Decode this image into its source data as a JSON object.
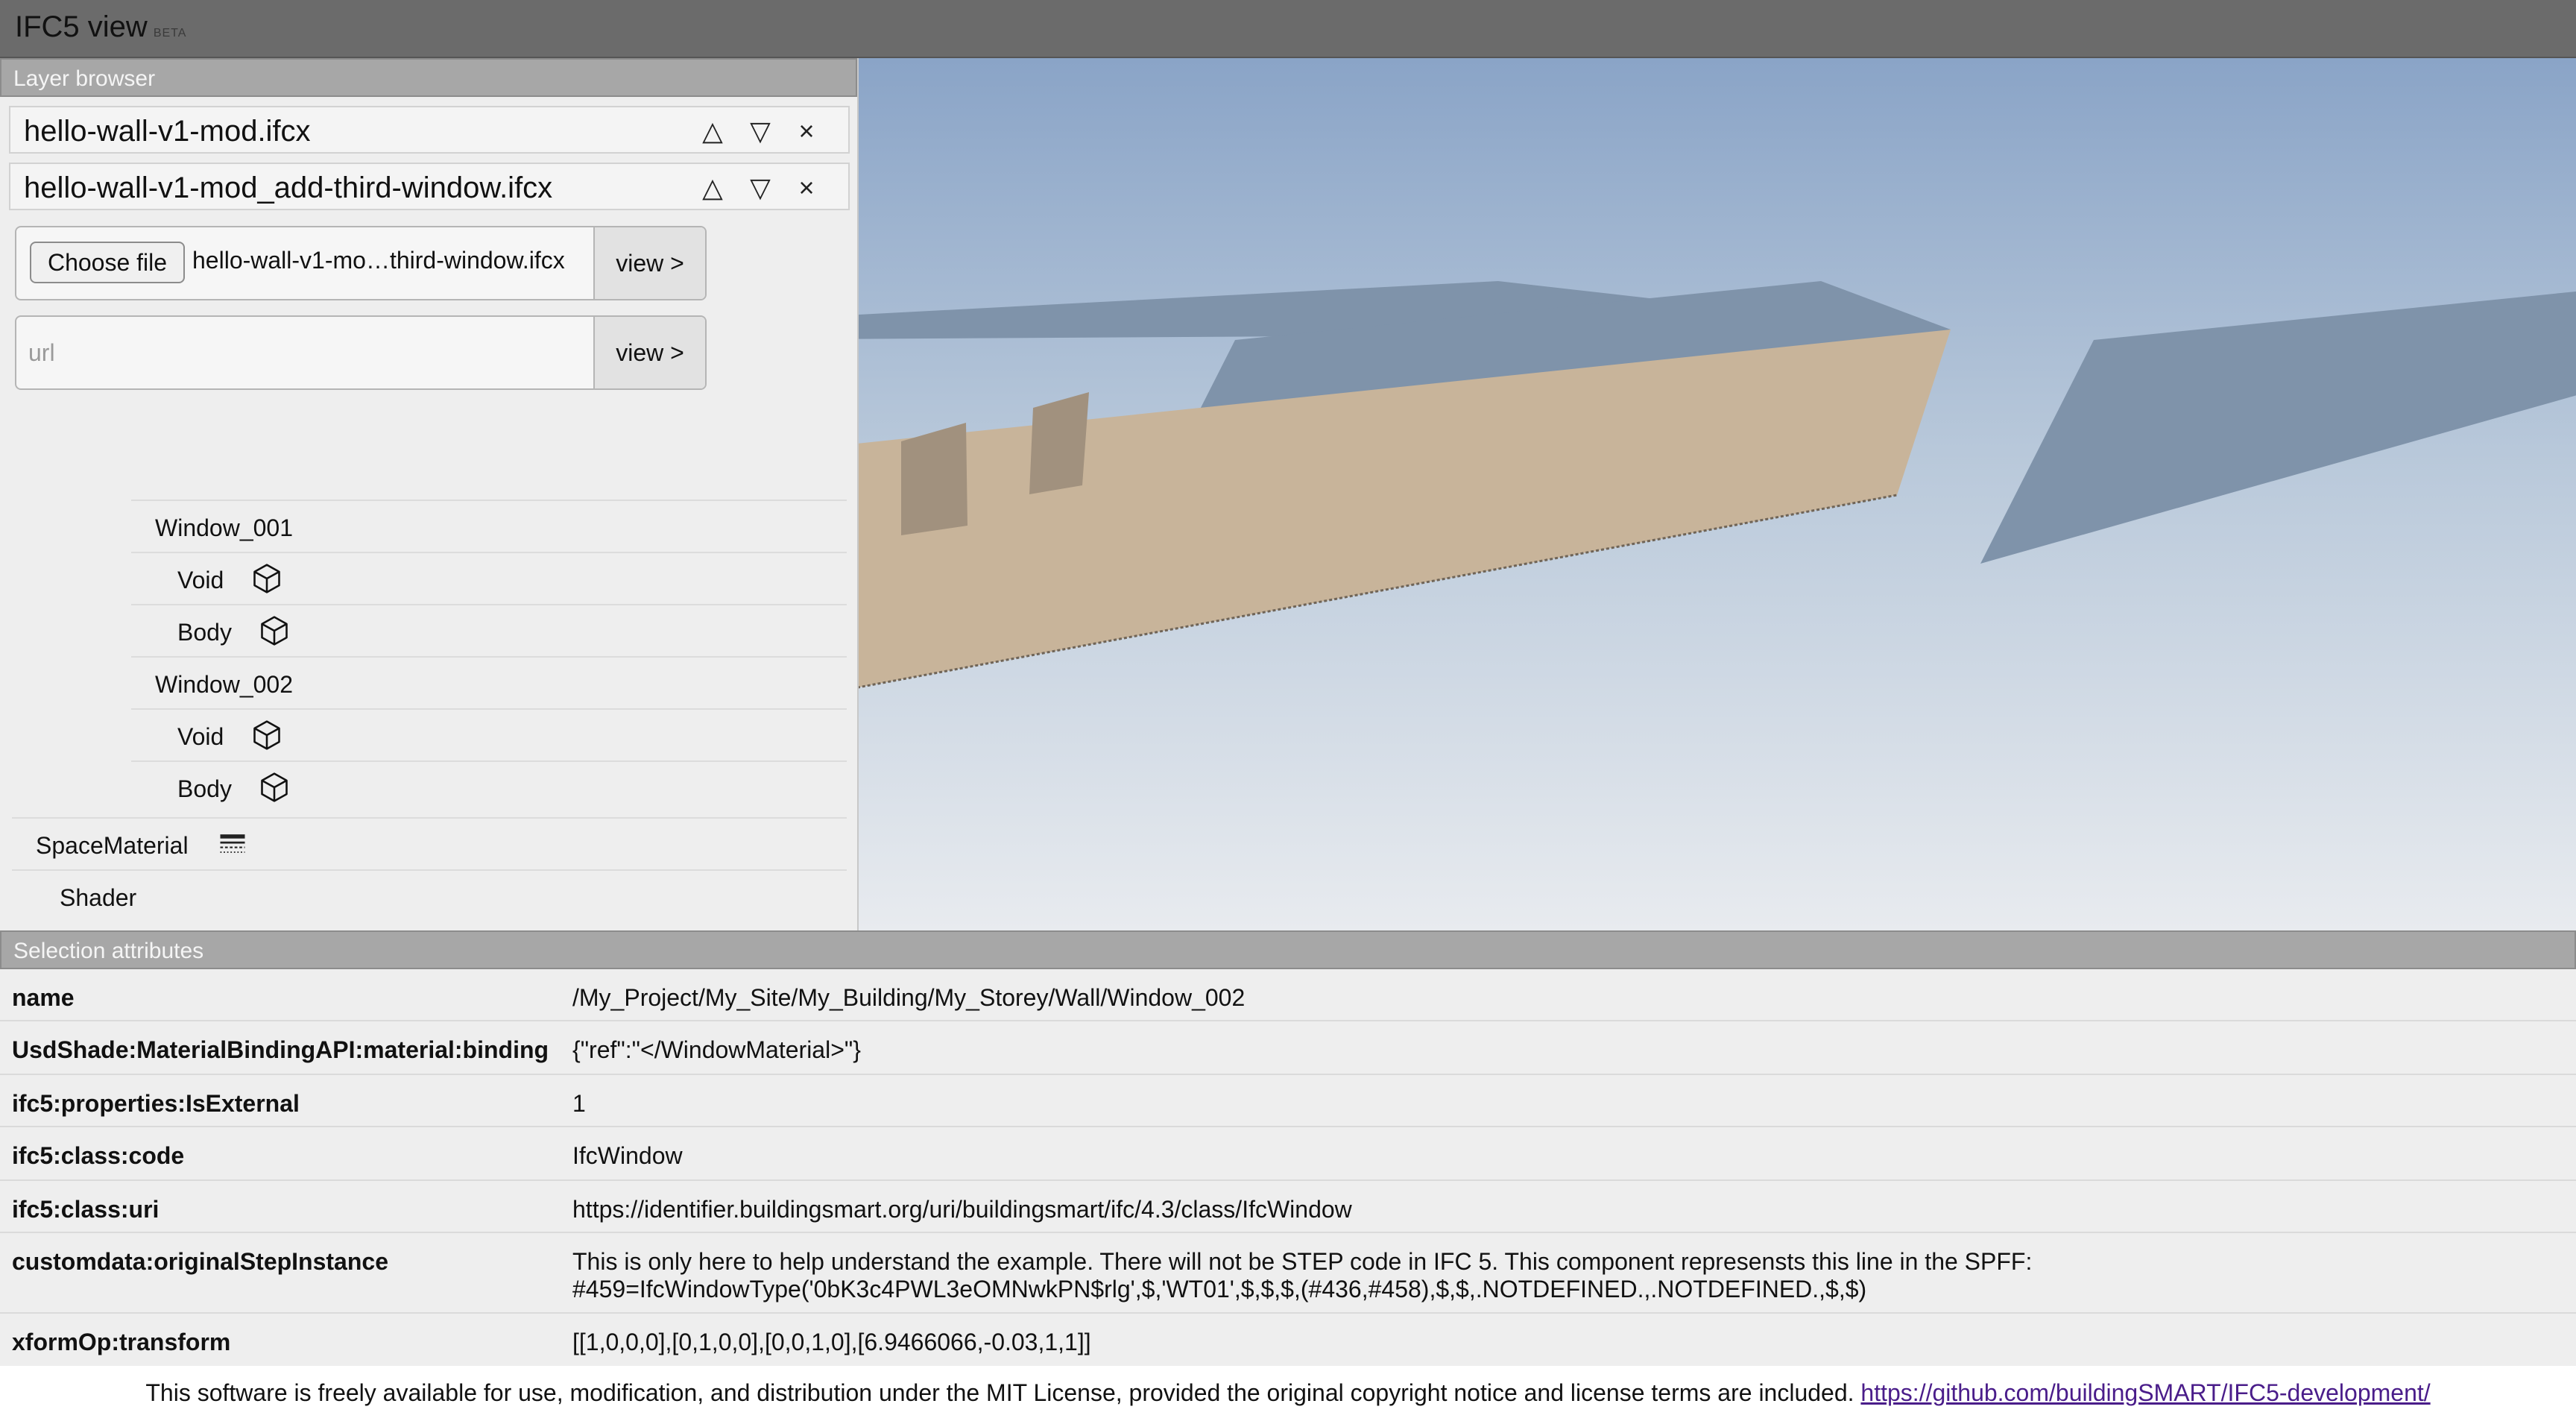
{
  "app": {
    "title": "IFC5 view",
    "badge": "BETA"
  },
  "layer_browser": {
    "header": "Layer browser",
    "layers": [
      {
        "name": "hello-wall-v1-mod.ifcx",
        "up_icon": "triangle-up-icon",
        "down_icon": "triangle-down-icon",
        "close_icon": "close-icon"
      },
      {
        "name": "hello-wall-v1-mod_add-third-window.ifcx",
        "up_icon": "triangle-up-icon",
        "down_icon": "triangle-down-icon",
        "close_icon": "close-icon"
      }
    ],
    "controls": {
      "up": "△",
      "down": "▽",
      "close": "×"
    },
    "file_picker": {
      "choose_label": "Choose file",
      "file_name": "hello-wall-v1-mo…third-window.ifcx",
      "view_label": "view >"
    },
    "url_input": {
      "placeholder": "url",
      "value": "",
      "view_label": "view >"
    }
  },
  "tree": [
    {
      "label": "Window_001",
      "icon": null
    },
    {
      "label": "Void",
      "icon": "cube-icon"
    },
    {
      "label": "Body",
      "icon": "cube-icon"
    },
    {
      "label": "Window_002",
      "icon": null
    },
    {
      "label": "Void",
      "icon": "cube-icon"
    },
    {
      "label": "Body",
      "icon": "cube-icon"
    },
    {
      "label": "SpaceMaterial",
      "icon": "material-icon"
    },
    {
      "label": "Shader",
      "icon": null
    }
  ],
  "viewport": {
    "colors": {
      "sky_top": "#8aa4c7",
      "sky_bottom": "#e8ebef",
      "wall": "#c8b49a",
      "wall_top": "#7f93aa",
      "window": "#a1917e"
    }
  },
  "selection_attributes": {
    "header": "Selection attributes",
    "rows": [
      {
        "key": "name",
        "value": "/My_Project/My_Site/My_Building/My_Storey/Wall/Window_002"
      },
      {
        "key": "UsdShade:MaterialBindingAPI:material:binding",
        "value": "{\"ref\":\"</WindowMaterial>\"}"
      },
      {
        "key": "ifc5:properties:IsExternal",
        "value": "1"
      },
      {
        "key": "ifc5:class:code",
        "value": "IfcWindow"
      },
      {
        "key": "ifc5:class:uri",
        "value": "https://identifier.buildingsmart.org/uri/buildingsmart/ifc/4.3/class/IfcWindow"
      },
      {
        "key": "customdata:originalStepInstance",
        "value": "This is only here to help understand the example. There will not be STEP code in IFC 5. This component represensts this line in the SPFF:",
        "value2": "#459=IfcWindowType('0bK3c4PWL3eOMNwkPN$rlg',$,'WT01',$,$,$,(#436,#458),$,$,.NOTDEFINED.,.NOTDEFINED.,$,$)"
      },
      {
        "key": "xformOp:transform",
        "value": "[[1,0,0,0],[0,1,0,0],[0,0,1,0],[6.9466066,-0.03,1,1]]"
      }
    ]
  },
  "footer": {
    "text": "This software is freely available for use, modification, and distribution under the MIT License, provided the original copyright notice and license terms are included. ",
    "link_text": "https://github.com/buildingSMART/IFC5-development/"
  }
}
